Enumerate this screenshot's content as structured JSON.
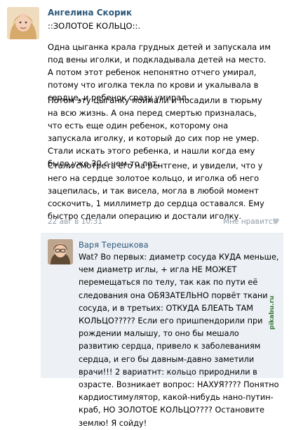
{
  "post": {
    "author": "Ангелина Скорик",
    "title": "::ЗОЛОТОЕ КОЛЬЦО::.",
    "paragraphs": [
      "Одна цыганка крала грудных детей и запускала им под вены иголки, и подкладывала детей на место. А потом этот ребенок непонятно отчего умирал, потому что иголка текла по крови и укалывала в сердце, и ребенок сразу умирал.",
      "Потом эту цыганку поймали и посадили в тюрьму на всю жизнь. А она перед смертью призналась, что есть еще один ребенок, которому она запускала иголку, и который до сих пор не умер. Стали искать этого ребенка, и нашли когда ему было уже 30 с чем-то лет.",
      "Стали смотреть его на рентгене, и увидели, что у него на сердце золотое кольцо, и иголка об него зацепилась, и так висела, могла в любой момент соскочить, 1 миллиметр до сердца оставался. Ему быстро сделали операцию и достали иголку."
    ],
    "date": "22 авг в 10:31",
    "like_label": "Мне нравится",
    "heart_icon": "heart-icon"
  },
  "comment": {
    "author": "Варя Терешкова",
    "text": "Wat? Во первых: диаметр сосуда КУДА меньше, чем диаметр иглы, + игла НЕ МОЖЕТ перемещаться по телу, так как по пути её следования она ОБЯЗАТЕЛЬНО порвёт ткани сосуда, и в третьих: ОТКУДА БЛЕАТЬ ТАМ КОЛЬЦО????? Если его пришпендорили при рождении малышу, то оно бы мешало развитию сердца, привело к заболеваниям сердца, и его бы давным-давно заметили врачи!!! 2 вариатнт: кольцо природнили в озрасте. Возникает вопрос: НАХУЯ???? Понятно кардиостимулятор, какой-нибудь нано-путин-краб, НО ЗОЛОТОЕ КОЛЬЦО???? Остановите землю! Я сойду!",
    "ellipsis": "..."
  },
  "watermark": "pikabu.ru"
}
